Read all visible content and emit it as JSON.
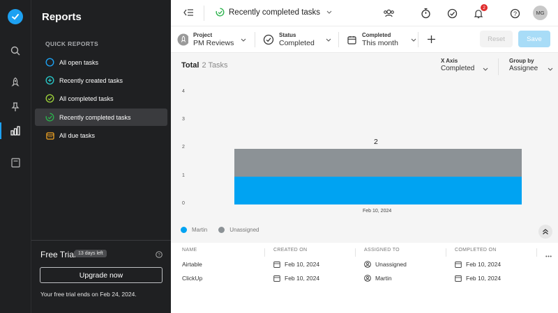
{
  "sidebar": {
    "title": "Reports",
    "section_label": "QUICK REPORTS",
    "items": [
      {
        "label": "All open tasks",
        "icon": "circle-open-icon"
      },
      {
        "label": "Recently created tasks",
        "icon": "plus-circle-icon"
      },
      {
        "label": "All completed tasks",
        "icon": "check-circle-icon"
      },
      {
        "label": "Recently completed tasks",
        "icon": "recent-check-icon"
      },
      {
        "label": "All due tasks",
        "icon": "calendar-icon"
      }
    ],
    "active_index": 3,
    "trial": {
      "title": "Free Trial",
      "badge": "13 days left",
      "button": "Upgrade now",
      "ends_text": "Your free trial ends on Feb 24, 2024."
    }
  },
  "topbar": {
    "report_title": "Recently completed tasks",
    "notification_count": "2",
    "avatar_initials": "MG"
  },
  "filters": {
    "project": {
      "label": "Project",
      "value": "PM Reviews"
    },
    "status": {
      "label": "Status",
      "value": "Completed"
    },
    "completed": {
      "label": "Completed",
      "value": "This month"
    },
    "reset_label": "Reset",
    "save_label": "Save"
  },
  "chart_header": {
    "total_label": "Total",
    "total_count": "2 Tasks",
    "x_axis": {
      "label": "X Axis",
      "value": "Completed"
    },
    "group_by": {
      "label": "Group by",
      "value": "Assignee"
    }
  },
  "chart_data": {
    "type": "bar",
    "stacked": true,
    "categories": [
      "Feb 10, 2024"
    ],
    "series": [
      {
        "name": "Martin",
        "values": [
          1
        ],
        "color": "#00a3f2"
      },
      {
        "name": "Unassigned",
        "values": [
          1
        ],
        "color": "#8c9296"
      }
    ],
    "totals": [
      2
    ],
    "ylim": [
      0,
      4
    ],
    "yticks": [
      "4",
      "3",
      "2",
      "1",
      "0"
    ],
    "legend": "bottom-left",
    "title": "",
    "xlabel": "",
    "ylabel": ""
  },
  "table": {
    "columns": [
      "NAME",
      "CREATED ON",
      "ASSIGNED TO",
      "COMPLETED ON"
    ],
    "rows": [
      {
        "name": "Airtable",
        "created": "Feb 10, 2024",
        "assigned": "Unassigned",
        "completed": "Feb 10, 2024"
      },
      {
        "name": "ClickUp",
        "created": "Feb 10, 2024",
        "assigned": "Martin",
        "completed": "Feb 10, 2024"
      }
    ]
  },
  "colors": {
    "accent": "#1da1f2",
    "sidebar_bg": "#1f2022",
    "check_green": "#2bb24c",
    "due_orange": "#f5a623"
  }
}
